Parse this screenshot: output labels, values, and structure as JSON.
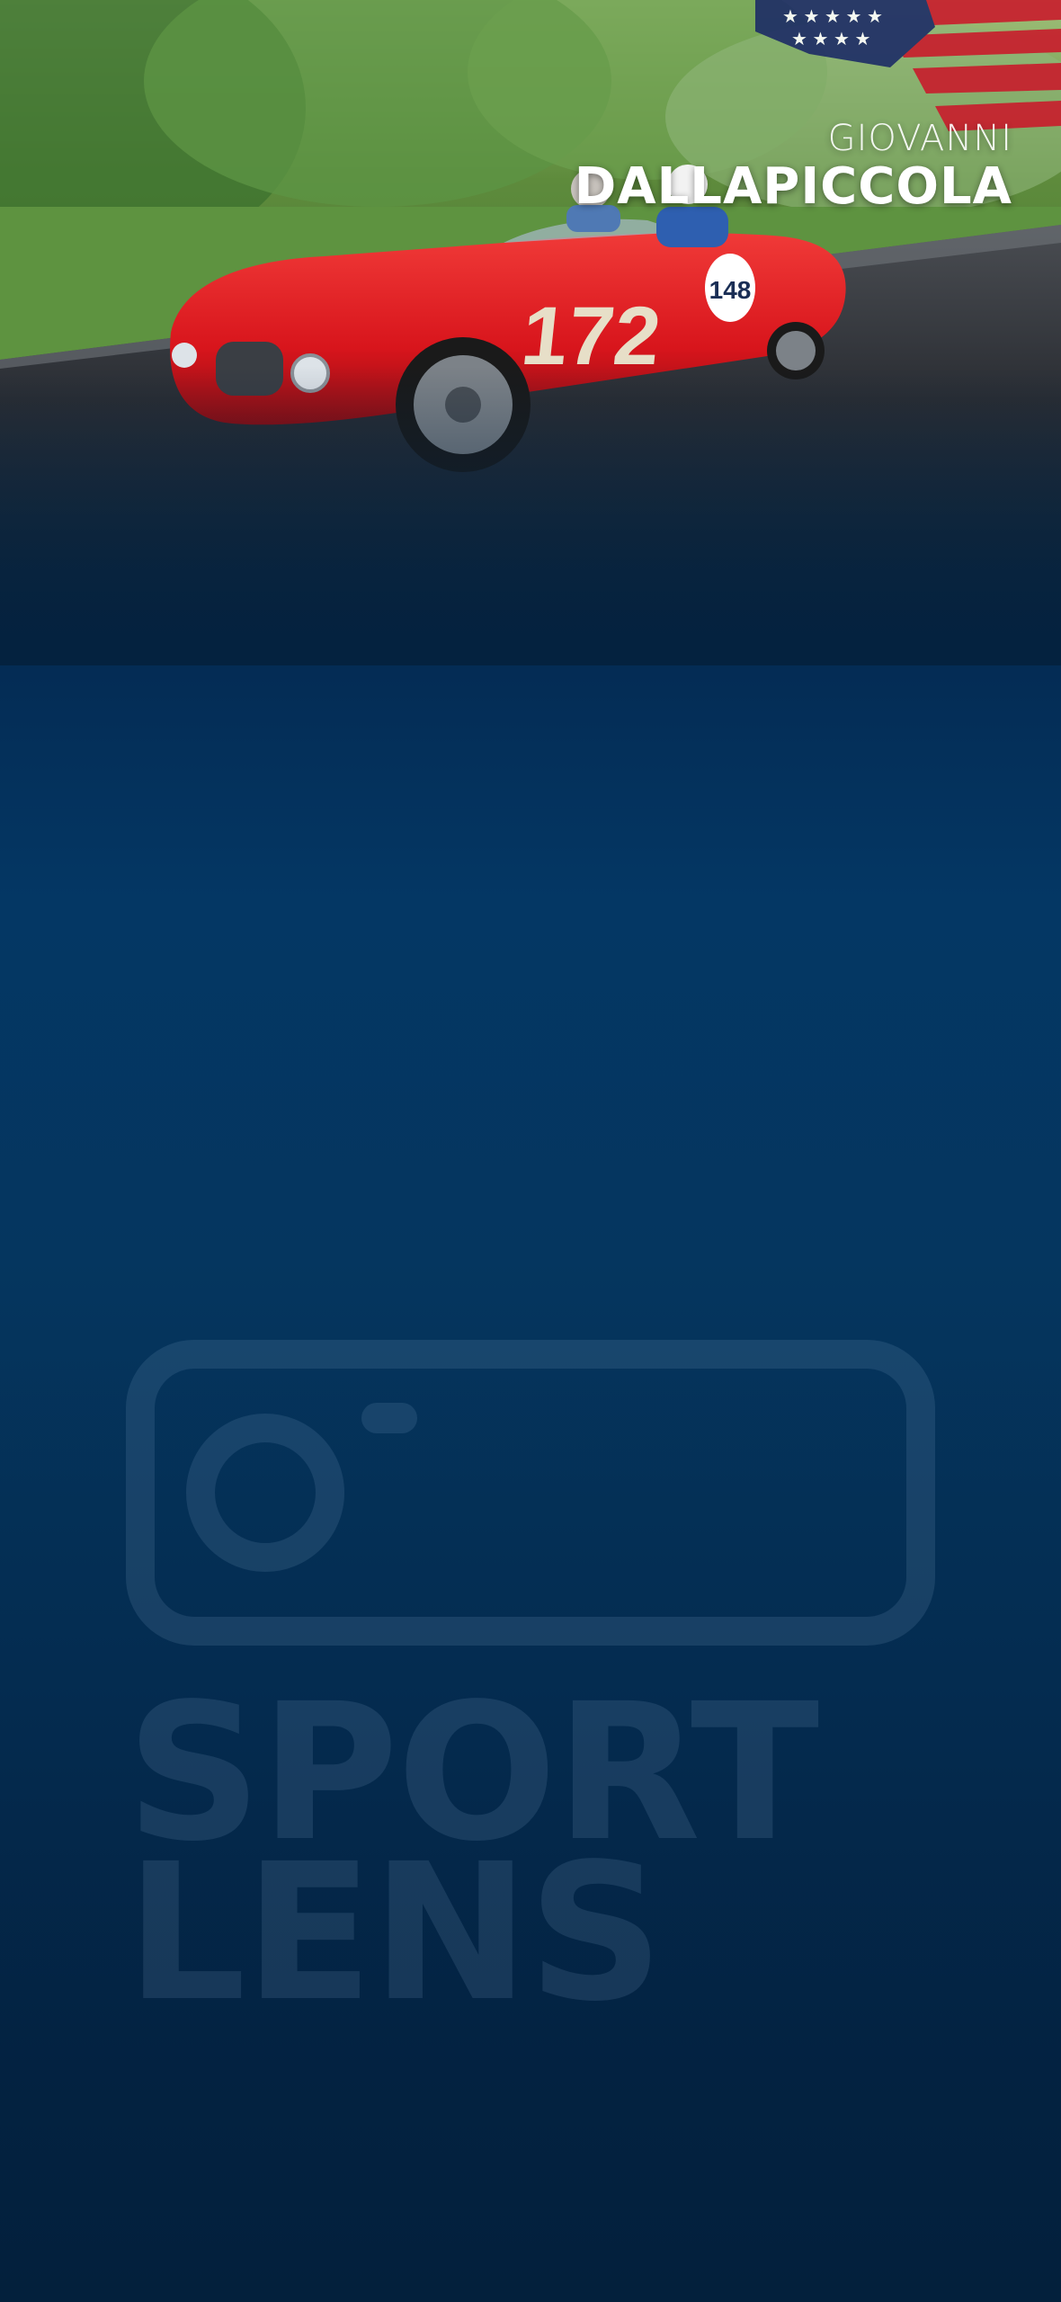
{
  "driver": {
    "first_name": "GIOVANNI",
    "last_name": "DALLAPICCOLA",
    "flag": "flag-usa-icon"
  },
  "car": {
    "number": "172",
    "plate_number": "148",
    "color": "#d8151c"
  },
  "watermark": {
    "icon": "camera-icon",
    "line1": "SPORT",
    "line2": "LENS"
  },
  "colors": {
    "background_top": "#04223f",
    "background_mid": "#043764",
    "background_bottom": "#03203c"
  }
}
